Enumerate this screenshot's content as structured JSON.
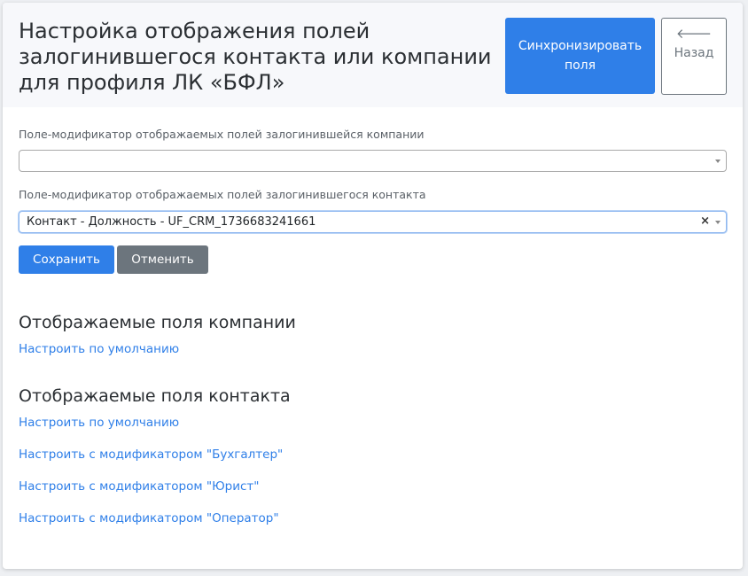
{
  "header": {
    "title": "Настройка отображения полей залогинившегося контакта или компании для профиля ЛК «БФЛ»",
    "sync_button_label": "Синхронизировать поля",
    "back_button_label": "Назад",
    "back_icon": "arrow-left-icon"
  },
  "form": {
    "company_modifier": {
      "label": "Поле-модификатор отображаемых полей залогинившейся компании",
      "value": ""
    },
    "contact_modifier": {
      "label": "Поле-модификатор отображаемых полей залогинившегося контакта",
      "value": "Контакт - Должность - UF_CRM_1736683241661",
      "clear_symbol": "×"
    },
    "save_label": "Сохранить",
    "cancel_label": "Отменить"
  },
  "company_fields": {
    "title": "Отображаемые поля компании",
    "links": [
      "Настроить по умолчанию"
    ]
  },
  "contact_fields": {
    "title": "Отображаемые поля контакта",
    "links": [
      "Настроить по умолчанию",
      "Настроить с модификатором \"Бухгалтер\"",
      "Настроить с модификатором \"Юрист\"",
      "Настроить с модификатором \"Оператор\""
    ]
  },
  "colors": {
    "primary": "#2f7fe8",
    "secondary": "#6c757d",
    "header_bg": "#f7f8fb"
  }
}
